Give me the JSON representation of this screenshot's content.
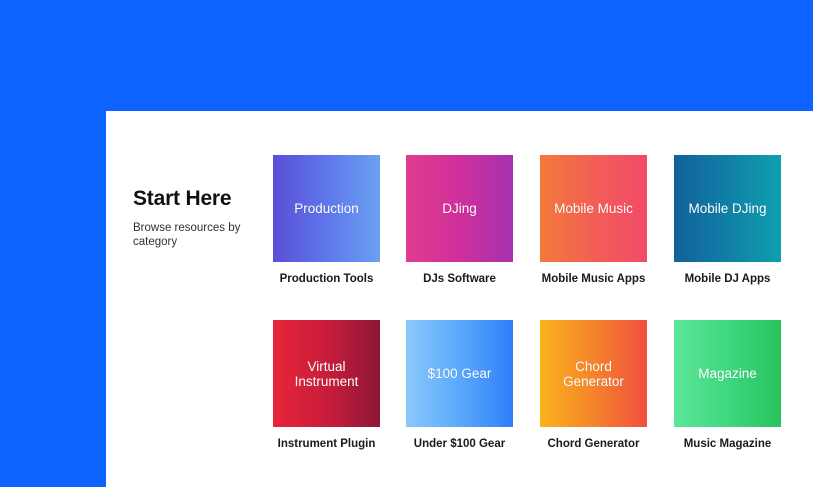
{
  "intro": {
    "title": "Start Here",
    "subtitle": "Browse resources by category"
  },
  "tiles": [
    {
      "image_text": "Production",
      "caption": "Production Tools",
      "color": "#5d72e8"
    },
    {
      "image_text": "DJing",
      "caption": "DJs Software",
      "color": "#cf2f9b"
    },
    {
      "image_text": "Mobile Music",
      "caption": "Mobile Music Apps",
      "color": "#f25a5a"
    },
    {
      "image_text": "Mobile DJing",
      "caption": "Mobile DJ Apps",
      "color": "#107fa6"
    },
    {
      "image_text": "Virtual Instrument",
      "caption": "Instrument Plugin",
      "color": "#c81d3a"
    },
    {
      "image_text": "$100 Gear",
      "caption": "Under $100 Gear",
      "color": "#5aa9fb"
    },
    {
      "image_text": "Chord Generator",
      "caption": "Chord Generator",
      "color": "#f5842b"
    },
    {
      "image_text": "Magazine",
      "caption": "Music Magazine",
      "color": "#3fd77f"
    }
  ],
  "colors": {
    "background": "#0d63ff",
    "panel": "#ffffff"
  }
}
